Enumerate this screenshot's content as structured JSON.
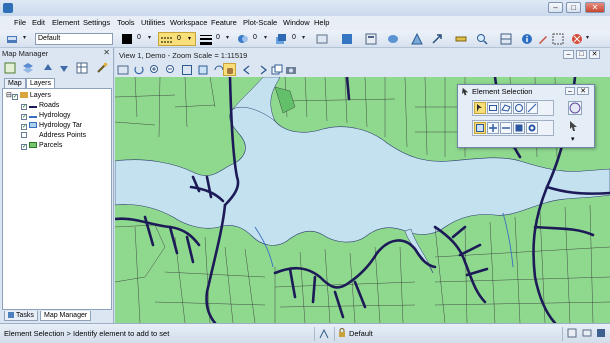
{
  "window": {
    "minimize": "–",
    "maximize": "□",
    "close": "✕"
  },
  "menu": [
    "File",
    "Edit",
    "Element",
    "Settings",
    "Tools",
    "Utilities",
    "Workspace",
    "Feature",
    "Plot-Scale",
    "Window",
    "Help"
  ],
  "toolbar": {
    "level_value": "Default",
    "color_value": "0",
    "style_value": "0",
    "weight_value": "0",
    "transparency_value": "0",
    "priority_value": "0"
  },
  "map_manager": {
    "title": "Map Manager",
    "tabs": [
      "Map",
      "Layers"
    ],
    "tree": [
      {
        "label": "Layers",
        "checked": true,
        "swatch": "#d8a63c"
      },
      {
        "label": "Roads",
        "checked": true,
        "swatch": "#1b1b5c"
      },
      {
        "label": "Hydrology",
        "checked": true,
        "swatch": "#3a6fc2"
      },
      {
        "label": "Hydrology Tar",
        "checked": true,
        "swatch": "#a9cfe9"
      },
      {
        "label": "Address Points",
        "checked": false,
        "swatch": ""
      },
      {
        "label": "Parcels",
        "checked": true,
        "swatch": "#79c36c"
      }
    ],
    "bottom_tabs": [
      "Tasks",
      "Map Manager"
    ]
  },
  "view": {
    "title": "View 1, Demo - Zoom Scale = 1:11519"
  },
  "dialog": {
    "title": "Element Selection"
  },
  "status": {
    "prompt": "Element Selection > Identify element to add to set",
    "level": "Default"
  },
  "colors": {
    "land": "#8fd98f",
    "water": "#c3e1ef",
    "roads": "#1d1b57",
    "parcel_lines": "#333333"
  }
}
